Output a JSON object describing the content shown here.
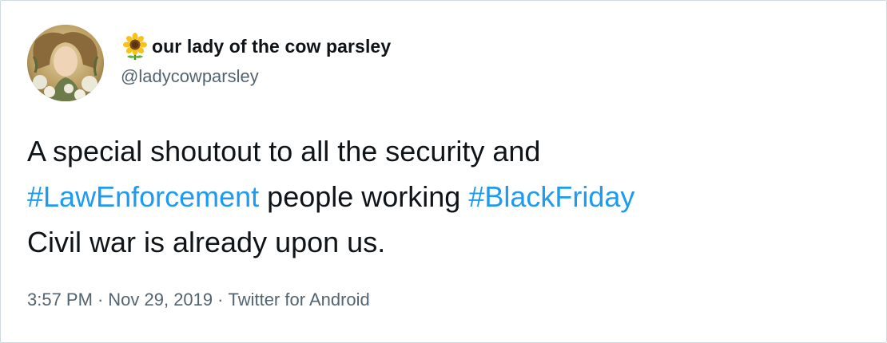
{
  "user": {
    "name_emoji_icon": "sunflower-icon",
    "display_name": "our lady of the cow parsley",
    "handle": "@ladycowparsley"
  },
  "tweet": {
    "line1": "A special shoutout to all the security and",
    "line2_hashtag1": "#LawEnforcement",
    "line2_text": " people working ",
    "line2_hashtag2": "#BlackFriday",
    "line3": "Civil war is already upon us."
  },
  "meta": {
    "time": "3:57 PM",
    "separator": "·",
    "date": "Nov 29, 2019",
    "source": "Twitter for Android"
  },
  "colors": {
    "hashtag": "#1d9bf0",
    "secondary_text": "#536471",
    "primary_text": "#0f1419",
    "border": "#cfd9de"
  }
}
